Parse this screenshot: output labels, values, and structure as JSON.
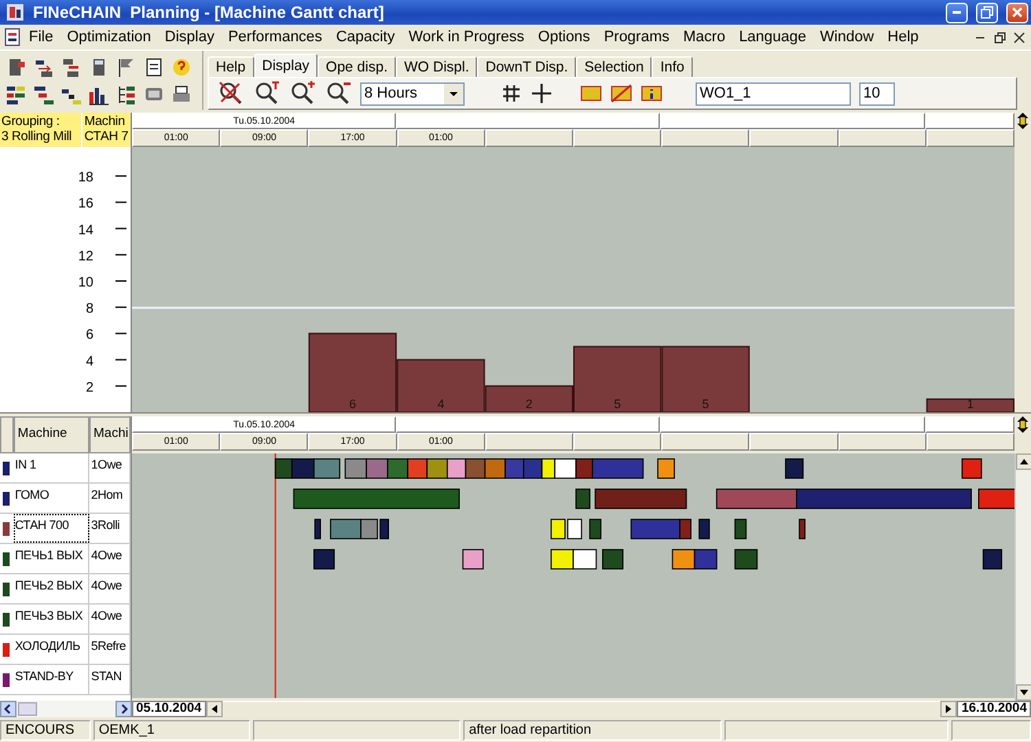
{
  "window": {
    "title": "FINeCHAIN  Planning - [Machine Gantt chart]"
  },
  "menu": [
    "File",
    "Optimization",
    "Display",
    "Performances",
    "Capacity",
    "Work in Progress",
    "Options",
    "Programs",
    "Macro",
    "Language",
    "Window",
    "Help"
  ],
  "tabs": [
    {
      "label": "Help",
      "selected": false
    },
    {
      "label": "Display",
      "selected": true
    },
    {
      "label": "Ope disp.",
      "selected": false
    },
    {
      "label": "WO Displ.",
      "selected": false
    },
    {
      "label": "DownT Disp.",
      "selected": false
    },
    {
      "label": "Selection",
      "selected": false
    },
    {
      "label": "Info",
      "selected": false
    }
  ],
  "display_toolbar": {
    "period": "8 Hours",
    "order_field": "WO1_1",
    "count_field": "10"
  },
  "load_panel": {
    "grouping_label": "Grouping :",
    "grouping_value": "3 Rolling Mill",
    "machine_label": "Machin",
    "machine_value": "СТАН 7",
    "date": "Tu.05.10.2004",
    "times": [
      "01:00",
      "09:00",
      "17:00",
      "01:00"
    ],
    "chart_data": {
      "type": "bar",
      "values": [
        0,
        0,
        6,
        4,
        2,
        5,
        5,
        0,
        0,
        1
      ],
      "ylim": [
        0,
        20
      ],
      "yticks": [
        2,
        4,
        6,
        8,
        10,
        12,
        14,
        16,
        18
      ],
      "value_labels": [
        null,
        null,
        "6",
        "4",
        "2",
        "5",
        "5",
        null,
        null,
        "1"
      ]
    }
  },
  "gantt": {
    "columns": [
      "Machine",
      "Machi"
    ],
    "date": "Tu.05.10.2004",
    "times": [
      "01:00",
      "09:00",
      "17:00",
      "01:00"
    ],
    "start_date": "05.10.2004",
    "end_date": "16.10.2004",
    "machines": [
      {
        "color": "#1a1f6e",
        "name": "IN 1",
        "column_2": "1Owe",
        "selected": false
      },
      {
        "color": "#1a1f6e",
        "name": "ГОМО",
        "column_2": "2Hom",
        "selected": false
      },
      {
        "color": "#8a3a3a",
        "name": "СТАН 700",
        "column_2": "3Rolli",
        "selected": true
      },
      {
        "color": "#1e4a1e",
        "name": "ПЕЧЬ1 ВЫХ",
        "column_2": "4Owe",
        "selected": false
      },
      {
        "color": "#1e4a1e",
        "name": "ПЕЧЬ2 ВЫХ",
        "column_2": "4Owe",
        "selected": false
      },
      {
        "color": "#1e4a1e",
        "name": "ПЕЧЬ3 ВЫХ",
        "column_2": "4Owe",
        "selected": false
      },
      {
        "color": "#d82010",
        "name": "ХОЛОДИЛЬ",
        "column_2": "5Refre",
        "selected": false
      },
      {
        "color": "#7a1a6a",
        "name": "STAND-BY",
        "column_2": "STAN",
        "selected": false
      }
    ]
  },
  "status_bar": [
    "ENCOURS",
    "OEMK_1",
    "after load repartition"
  ]
}
